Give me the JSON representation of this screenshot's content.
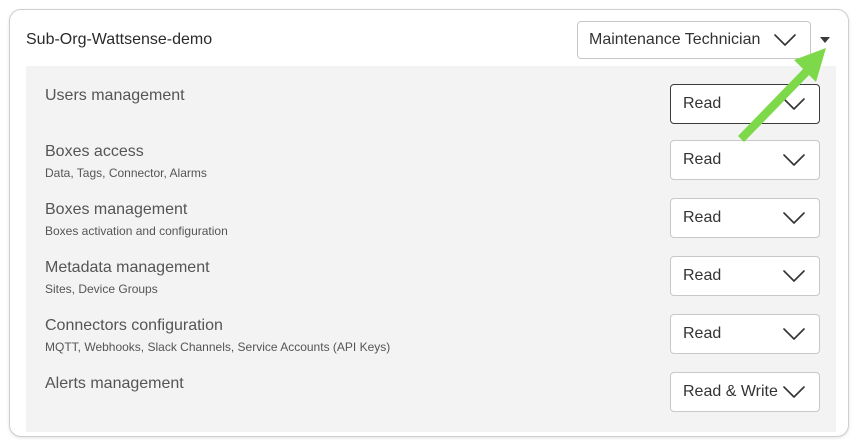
{
  "organization": {
    "name": "Sub-Org-Wattsense-demo"
  },
  "role_select": {
    "value": "Maintenance Technician"
  },
  "expand_toggle": {
    "icon": "caret-down-icon"
  },
  "permissions": [
    {
      "title": "Users management",
      "description": "",
      "value": "Read"
    },
    {
      "title": "Boxes access",
      "description": "Data, Tags, Connector, Alarms",
      "value": "Read"
    },
    {
      "title": "Boxes management",
      "description": "Boxes activation and configuration",
      "value": "Read"
    },
    {
      "title": "Metadata management",
      "description": "Sites, Device Groups",
      "value": "Read"
    },
    {
      "title": "Connectors configuration",
      "description": "MQTT, Webhooks, Slack Channels, Service Accounts (API Keys)",
      "value": "Read"
    },
    {
      "title": "Alerts management",
      "description": "",
      "value": "Read & Write"
    }
  ],
  "colors": {
    "annotation_arrow": "#7ed94a",
    "panel_background": "#f3f3f3"
  }
}
